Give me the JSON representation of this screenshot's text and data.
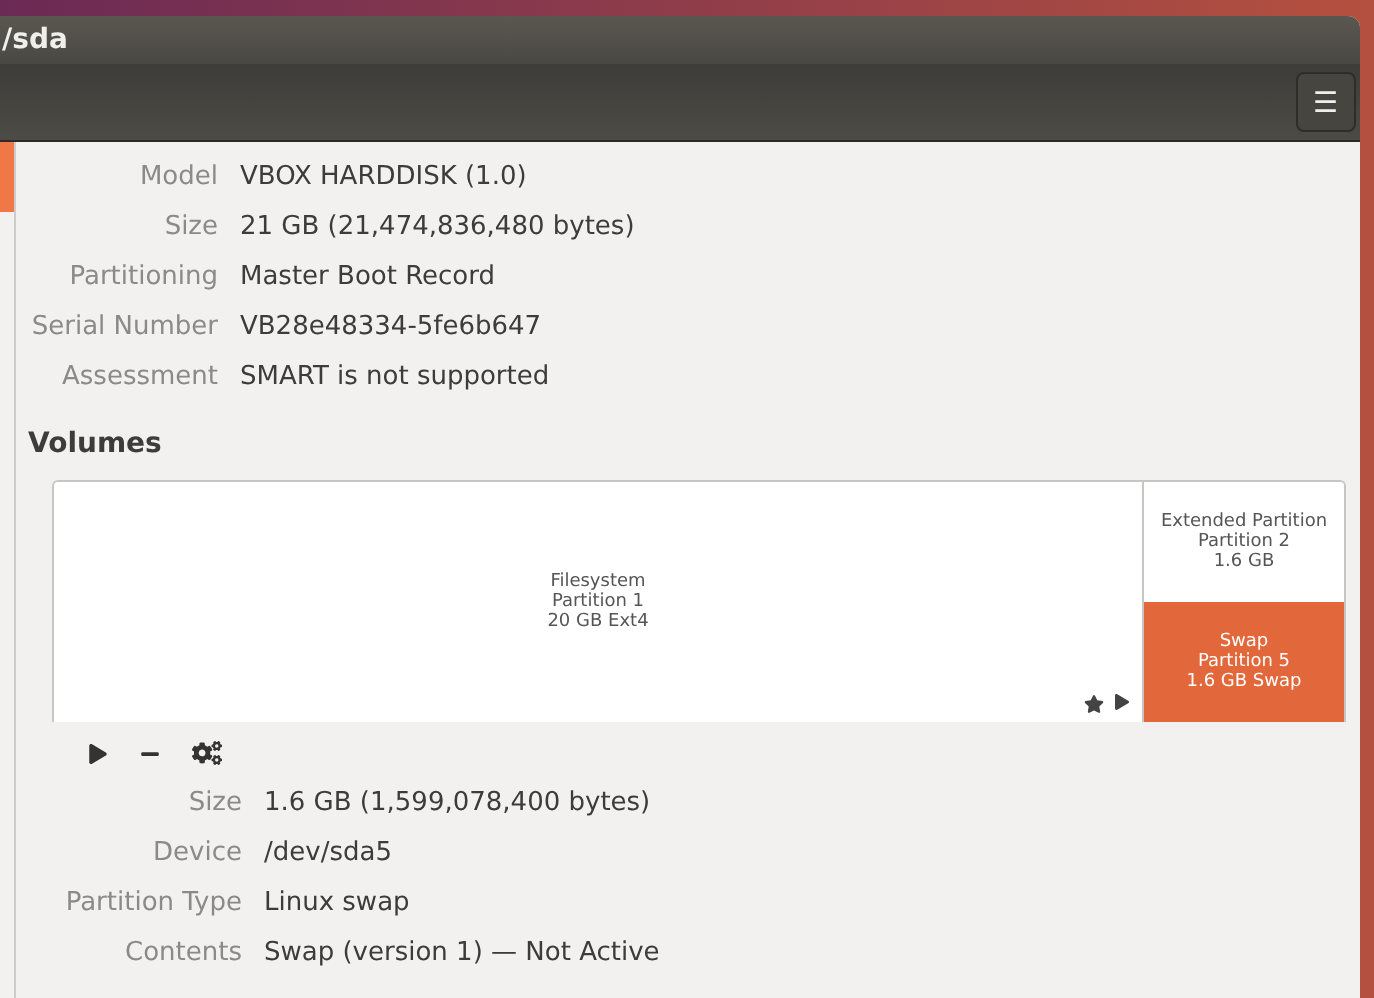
{
  "window": {
    "title": "/sda"
  },
  "header": {
    "menu_button": "☰"
  },
  "sidebar": {
    "items": [
      {
        "selected": true
      }
    ]
  },
  "drive_info": [
    {
      "label": "Model",
      "value": "VBOX HARDDISK (1.0)"
    },
    {
      "label": "Size",
      "value": "21 GB (21,474,836,480 bytes)"
    },
    {
      "label": "Partitioning",
      "value": "Master Boot Record"
    },
    {
      "label": "Serial Number",
      "value": "VB28e48334-5fe6b647"
    },
    {
      "label": "Assessment",
      "value": "SMART is not supported"
    }
  ],
  "volumes": {
    "title": "Volumes",
    "partitions": [
      {
        "lines": [
          "Filesystem",
          "Partition 1",
          "20 GB Ext4"
        ],
        "selected": false,
        "mounted_star": true
      },
      {
        "lines": [
          "Extended Partition",
          "Partition 2",
          "1.6 GB"
        ],
        "selected": false
      },
      {
        "lines": [
          "Swap",
          "Partition 5",
          "1.6 GB Swap"
        ],
        "selected": true
      }
    ]
  },
  "volume_info": [
    {
      "label": "Size",
      "value": "1.6 GB (1,599,078,400 bytes)"
    },
    {
      "label": "Device",
      "value": "/dev/sda5"
    },
    {
      "label": "Partition Type",
      "value": "Linux swap"
    },
    {
      "label": "Contents",
      "value": "Swap (version 1) — Not Active"
    }
  ]
}
